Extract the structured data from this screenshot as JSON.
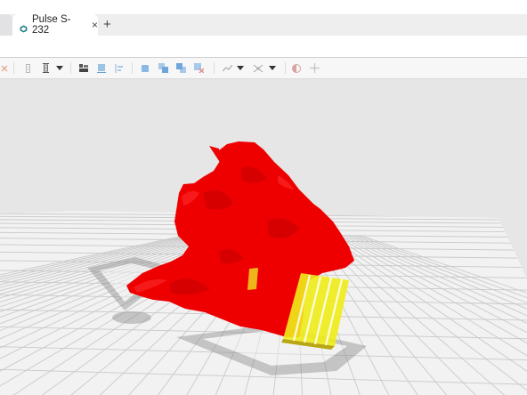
{
  "browser": {
    "tab": {
      "title": "Pulse S-232",
      "icon": "app-logo-icon",
      "close_glyph": "×"
    },
    "new_tab_glyph": "+"
  },
  "toolbar": {
    "buttons": [
      "close-icon",
      "toggle-icon",
      "layer-icon",
      "dropdown-icon",
      "grid-icon",
      "layout-icon",
      "align-icon",
      "cube-icon",
      "cube-front-icon",
      "cube-back-icon",
      "cube-delete-icon",
      "line-tool-icon",
      "dropdown-icon",
      "shape-tool-icon",
      "dropdown-icon",
      "contrast-icon",
      "split-icon"
    ]
  },
  "viewport": {
    "model_color": "#ee0000",
    "support_color": "#f0ec1a",
    "grid_color": "#c9c9c9",
    "plate_color": "#f2f2f2",
    "background_color": "#e6e6e6"
  }
}
